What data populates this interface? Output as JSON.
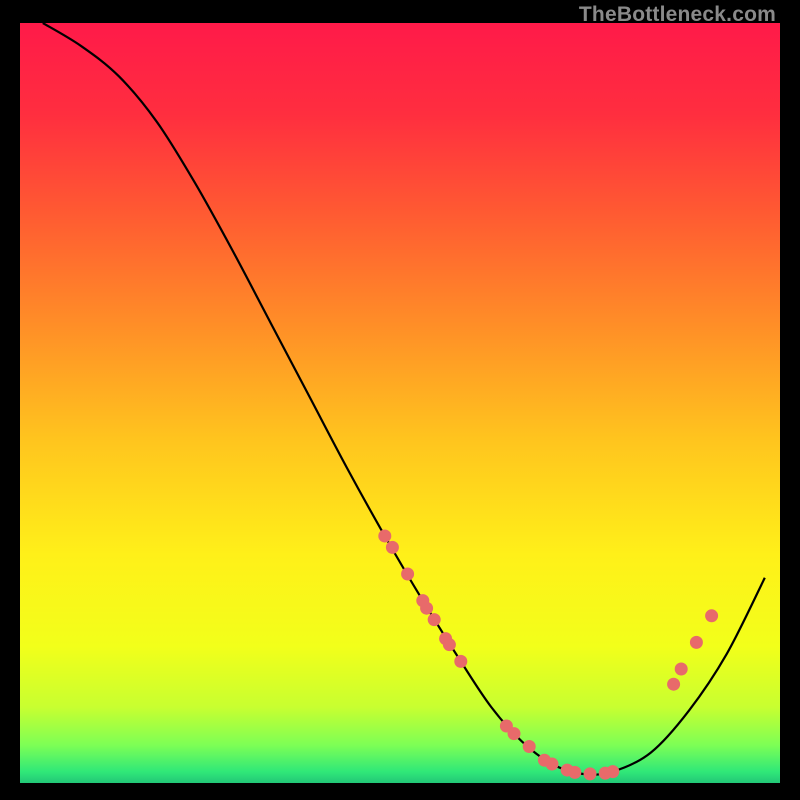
{
  "watermark": "TheBottleneck.com",
  "chart_data": {
    "type": "line",
    "title": "",
    "xlabel": "",
    "ylabel": "",
    "xlim": [
      0,
      100
    ],
    "ylim": [
      0,
      100
    ],
    "grid": false,
    "series": [
      {
        "name": "curve",
        "x": [
          3,
          8,
          13,
          18,
          23,
          28,
          33,
          38,
          43,
          48,
          53,
          58,
          62,
          66,
          70,
          74,
          78,
          83,
          88,
          93,
          98
        ],
        "y": [
          100,
          97,
          93,
          87,
          79,
          70,
          60.5,
          51,
          41.5,
          32.5,
          24,
          16,
          10,
          5.5,
          2.5,
          1.2,
          1.5,
          4,
          9.5,
          17,
          27
        ]
      }
    ],
    "markers": [
      {
        "x": 48,
        "y": 32.5
      },
      {
        "x": 49,
        "y": 31
      },
      {
        "x": 51,
        "y": 27.5
      },
      {
        "x": 53,
        "y": 24
      },
      {
        "x": 53.5,
        "y": 23
      },
      {
        "x": 54.5,
        "y": 21.5
      },
      {
        "x": 56,
        "y": 19
      },
      {
        "x": 56.5,
        "y": 18.2
      },
      {
        "x": 58,
        "y": 16
      },
      {
        "x": 64,
        "y": 7.5
      },
      {
        "x": 65,
        "y": 6.5
      },
      {
        "x": 67,
        "y": 4.8
      },
      {
        "x": 69,
        "y": 3
      },
      {
        "x": 70,
        "y": 2.5
      },
      {
        "x": 72,
        "y": 1.7
      },
      {
        "x": 73,
        "y": 1.4
      },
      {
        "x": 75,
        "y": 1.2
      },
      {
        "x": 77,
        "y": 1.3
      },
      {
        "x": 78,
        "y": 1.5
      },
      {
        "x": 86,
        "y": 13
      },
      {
        "x": 87,
        "y": 15
      },
      {
        "x": 89,
        "y": 18.5
      },
      {
        "x": 91,
        "y": 22
      }
    ],
    "gradient_stops": [
      {
        "offset": 0.0,
        "color": "#ff1a49"
      },
      {
        "offset": 0.12,
        "color": "#ff2e3f"
      },
      {
        "offset": 0.25,
        "color": "#ff5a32"
      },
      {
        "offset": 0.4,
        "color": "#ff8f27"
      },
      {
        "offset": 0.55,
        "color": "#ffc51e"
      },
      {
        "offset": 0.7,
        "color": "#fff019"
      },
      {
        "offset": 0.82,
        "color": "#f2ff1a"
      },
      {
        "offset": 0.9,
        "color": "#c8ff30"
      },
      {
        "offset": 0.95,
        "color": "#7dff55"
      },
      {
        "offset": 0.985,
        "color": "#30e878"
      },
      {
        "offset": 1.0,
        "color": "#22c777"
      }
    ],
    "marker_color": "#e86a6a",
    "curve_color": "#000000"
  }
}
